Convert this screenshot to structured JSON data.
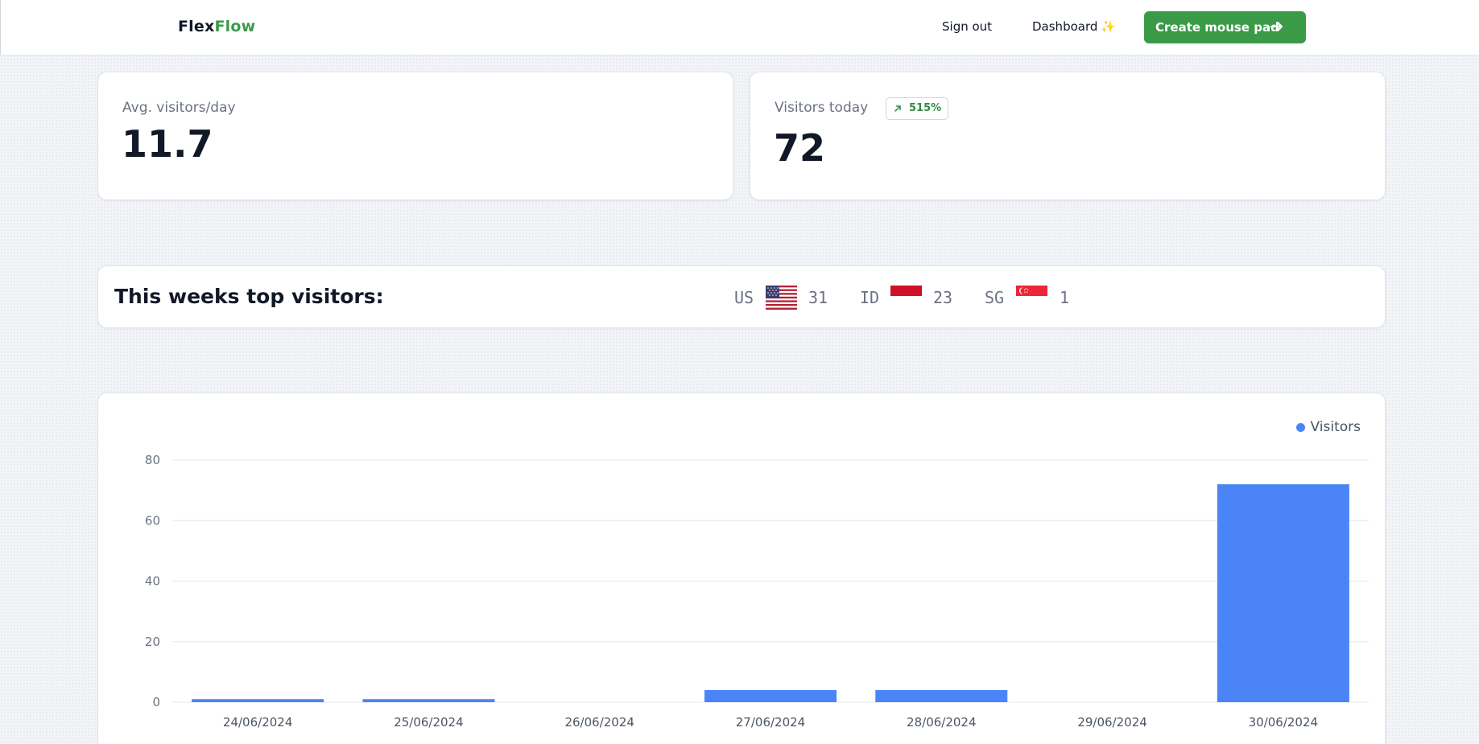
{
  "navbar": {
    "logo_part1": "Flex",
    "logo_part2": "Flow",
    "sign_out": "Sign out",
    "dashboard": "Dashboard",
    "dashboard_icon": "sparkle-icon",
    "cta_label": "Create mouse pad",
    "cta_icon": "arrow-right-icon",
    "brand_color": "#3b9a47"
  },
  "stats": {
    "avg_label": "Avg. visitors/day",
    "avg_value": "11.7",
    "today_label": "Visitors today",
    "today_value": "72",
    "today_change": "515%",
    "today_change_icon": "arrow-up-right-icon"
  },
  "top_visitors": {
    "title": "This weeks top visitors:",
    "countries": [
      {
        "code": "US",
        "count": "31",
        "flag": "us-flag-icon"
      },
      {
        "code": "ID",
        "count": "23",
        "flag": "indonesia-flag-icon"
      },
      {
        "code": "SG",
        "count": "1",
        "flag": "singapore-flag-icon"
      }
    ]
  },
  "chart_data": {
    "type": "bar",
    "categories": [
      "24/06/2024",
      "25/06/2024",
      "26/06/2024",
      "27/06/2024",
      "28/06/2024",
      "29/06/2024",
      "30/06/2024"
    ],
    "series": [
      {
        "name": "Visitors",
        "values": [
          1,
          1,
          0,
          4,
          4,
          0,
          72
        ],
        "color": "#4a84f7"
      }
    ],
    "yticks": [
      0,
      20,
      40,
      60,
      80
    ],
    "ylim": [
      0,
      80
    ],
    "grid": true,
    "legend_position": "top-right",
    "title": "",
    "xlabel": "",
    "ylabel": ""
  }
}
